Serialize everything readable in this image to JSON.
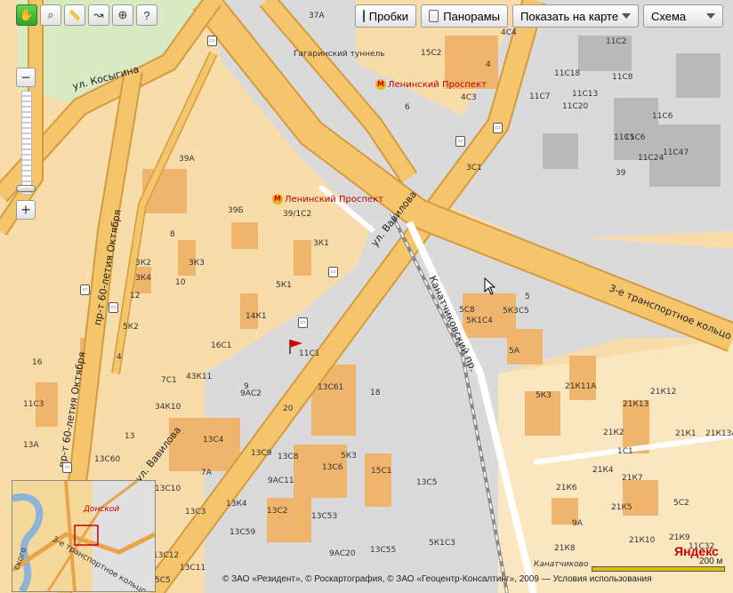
{
  "toolbar": {
    "tools": [
      {
        "name": "hand-tool-button",
        "icon": "hand-icon",
        "glyph": "✋",
        "active": true
      },
      {
        "name": "magnifier-tool-button",
        "icon": "magnifier-icon",
        "glyph": "⌕",
        "active": false
      },
      {
        "name": "ruler-tool-button",
        "icon": "ruler-icon",
        "glyph": "📏",
        "active": false
      },
      {
        "name": "route-tool-button",
        "icon": "route-icon",
        "glyph": "↝",
        "active": false
      },
      {
        "name": "placemark-tool-button",
        "icon": "placemark-icon",
        "glyph": "⊕",
        "active": false
      },
      {
        "name": "info-tool-button",
        "icon": "info-cursor-icon",
        "glyph": "?",
        "active": false
      }
    ],
    "traffic_label": "Пробки",
    "panoramas_label": "Панорамы",
    "show_on_map_label": "Показать на карте",
    "layer_label": "Схема"
  },
  "colors": {
    "road": "#f5c56b",
    "road_edge": "#d49b3e",
    "district": "#f8dcaa",
    "district_alt": "#fbe6c2",
    "building": "#f0b56c",
    "industrial": "#dadada",
    "industrial_building": "#b9b9b9",
    "park": "#d7eac2",
    "metro": "#c00000"
  },
  "streets": [
    {
      "text": "ул. Косыгина"
    },
    {
      "text": "пр-т 60-летия Октября"
    },
    {
      "text": "пр-т 60-летия Октября"
    },
    {
      "text": "ул. Вавилова"
    },
    {
      "text": "ул. Вавилова"
    },
    {
      "text": "Канатчиковский пр."
    },
    {
      "text": "3-е транспортное кольцо"
    },
    {
      "text": "Гагаринский туннель"
    },
    {
      "text": "Канатчиково"
    }
  ],
  "metro": [
    {
      "text": "Ленинский Проспект"
    },
    {
      "text": "Ленинский Проспект"
    }
  ],
  "labels": [
    "37А",
    "4С4",
    "15С2",
    "4",
    "4С3",
    "6",
    "3С1",
    "11С6",
    "11С8",
    "11С2",
    "11С18",
    "11С7",
    "11С13",
    "11С20",
    "11С6",
    "11С5",
    "11С24",
    "11С47",
    "39",
    "39А",
    "39Б",
    "39/1С2",
    "8",
    "3К1",
    "3К2",
    "3К3",
    "3К4",
    "10",
    "5К1",
    "12",
    "5К2",
    "14К1",
    "4",
    "16С1",
    "16",
    "7С1",
    "43К11",
    "11С1",
    "11С3",
    "9",
    "9АС2",
    "13С61",
    "18",
    "20",
    "34К10",
    "13",
    "13А",
    "13С4",
    "13С9",
    "13С8",
    "5К3",
    "13С6",
    "13С60",
    "7А",
    "9АС11",
    "15С1",
    "13С5",
    "13С10",
    "13С3",
    "13К4",
    "13С2",
    "13С53",
    "13С59",
    "13С12",
    "13С11",
    "9АС20",
    "13С55",
    "5К1С3",
    "5С5",
    "5С8",
    "5",
    "5К1С4",
    "5К3С5",
    "5А",
    "5К3",
    "21К11А",
    "21К12",
    "21К13",
    "21К2",
    "21К1",
    "21К13А",
    "1С1",
    "21К6",
    "21К4",
    "21К7",
    "21К5",
    "5С2",
    "9А",
    "21К8",
    "21К10",
    "21К9",
    "11С32"
  ],
  "minimap": {
    "labels": [
      "Донской",
      "3-е транспортное кольцо",
      "ского"
    ]
  },
  "copyright": "© ЗАО «Резидент», © Роскартография, © ЗАО «Геоцентр-Консалтинг», 2009 — Условия использования",
  "logo": "Яндекс",
  "scale_label": "200 м"
}
